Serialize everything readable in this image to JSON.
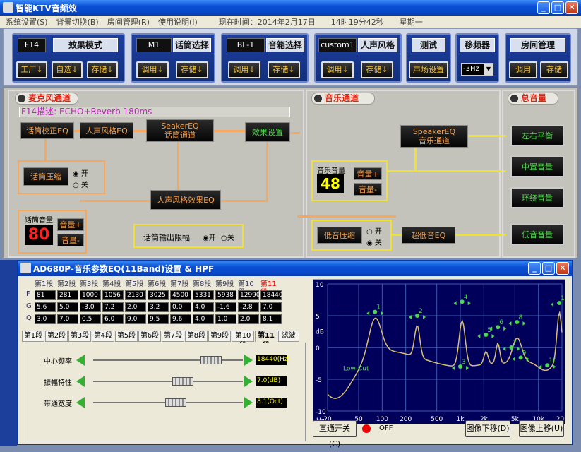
{
  "window": {
    "title": "智能KTV音频效"
  },
  "menu": {
    "items": [
      "系统设置(S)",
      "背景切换(B)",
      "房间管理(R)",
      "使用说明(I)",
      "现在时间：2014年2月17日",
      "14时19分42秒",
      "星期一"
    ]
  },
  "top": {
    "effect": {
      "lcd": "F14",
      "label": "效果模式",
      "btn1": "工厂↓",
      "btn2": "自选↓",
      "btn3": "存储↓"
    },
    "mic": {
      "lcd": "M1",
      "label": "话筒选择",
      "btn1": "调用↓",
      "btn2": "存储↓"
    },
    "speaker": {
      "lcd": "BL-1",
      "label": "音箱选择",
      "btn1": "调用↓",
      "btn2": "存储↓"
    },
    "voice": {
      "lcd": "custom1",
      "label": "人声风格",
      "btn1": "调用↓",
      "btn2": "存储↓"
    },
    "test": {
      "label": "测试",
      "btn": "声场设置"
    },
    "shift": {
      "label": "移频器",
      "value": "-3Hz"
    },
    "room": {
      "label": "房间管理",
      "btn1": "调用",
      "btn2": "存储"
    }
  },
  "mic_channel": {
    "title": "麦克风通道",
    "desc": "F14描述: ECHO+Reverb 180ms",
    "mic_eq": "话筒校正EQ",
    "voice_eq": "人声风格EQ",
    "seaker1": "SeakerEQ",
    "seaker2": "话筒通道",
    "effect_set": "效果设置",
    "compress": "话筒压缩",
    "on": "开",
    "off": "关",
    "voice_fx_eq": "人声风格效果EQ",
    "vol_label": "话筒音量",
    "vol": "80",
    "vol_up": "音量+",
    "vol_down": "音量-",
    "limit": "话筒输出限幅",
    "limit_on": "开",
    "limit_off": "关"
  },
  "music_channel": {
    "title": "音乐通道",
    "vol_label": "音乐音量",
    "vol": "48",
    "vol_up": "音量+",
    "vol_down": "音量-",
    "spk1": "SpeakerEQ",
    "spk2": "音乐通道",
    "bass_comp": "低音压缩",
    "on": "开",
    "off": "关",
    "sub_eq": "超低音EQ"
  },
  "master": {
    "title": "总音量",
    "lr": "左右平衡",
    "center": "中置音量",
    "surround": "环绕音量",
    "bass": "低音音量"
  },
  "eq": {
    "title": "AD680P-音乐参数EQ(11Band)设置 & HPF",
    "row_labels": [
      "F",
      "G",
      "Q"
    ],
    "bands": [
      "第1段",
      "第2段",
      "第3段",
      "第4段",
      "第5段",
      "第6段",
      "第7段",
      "第8段",
      "第9段",
      "第10段",
      "第11段"
    ],
    "F": [
      "81",
      "281",
      "1000",
      "1056",
      "2130",
      "3025",
      "4500",
      "5331",
      "5938",
      "12990",
      "18440"
    ],
    "G": [
      "5.6",
      "5.0",
      "-3.0",
      "7.2",
      "2.0",
      "3.2",
      "0.0",
      "4.0",
      "-1.6",
      "-2.8",
      "7.0"
    ],
    "Q": [
      "3.0",
      "7.0",
      "0.5",
      "6.0",
      "9.0",
      "9.5",
      "9.6",
      "4.0",
      "1.0",
      "2.0",
      "8.1"
    ],
    "tabs": [
      "第1段",
      "第2段",
      "第3段",
      "第4段",
      "第5段",
      "第6段",
      "第7段",
      "第8段",
      "第9段",
      "第10段",
      "第11段",
      "滤波"
    ],
    "sliders": [
      {
        "label": "中心频率",
        "value": "18440(Hz)",
        "pos": 0.79
      },
      {
        "label": "振幅特性",
        "value": "7.0(dB)",
        "pos": 0.6
      },
      {
        "label": "带通宽度",
        "value": "8.1(Oct)",
        "pos": 0.55
      }
    ],
    "bypass": "直通开关(C)",
    "off": "OFF",
    "move_down": "图像下移(D)",
    "move_up": "图像上移(U)",
    "graph": {
      "y_ticks": [
        "10",
        "5",
        "dB",
        "0",
        "-5",
        "-10"
      ],
      "x_ticks": [
        "Hz",
        "20",
        "50",
        "100",
        "200",
        "500",
        "1k",
        "2k",
        "5k",
        "10k",
        "20k"
      ],
      "lowcut": "Low-Cut",
      "point_labels": [
        "1",
        "2",
        "3",
        "4",
        "5",
        "6",
        "7",
        "8",
        "9",
        "10",
        "11"
      ]
    }
  }
}
